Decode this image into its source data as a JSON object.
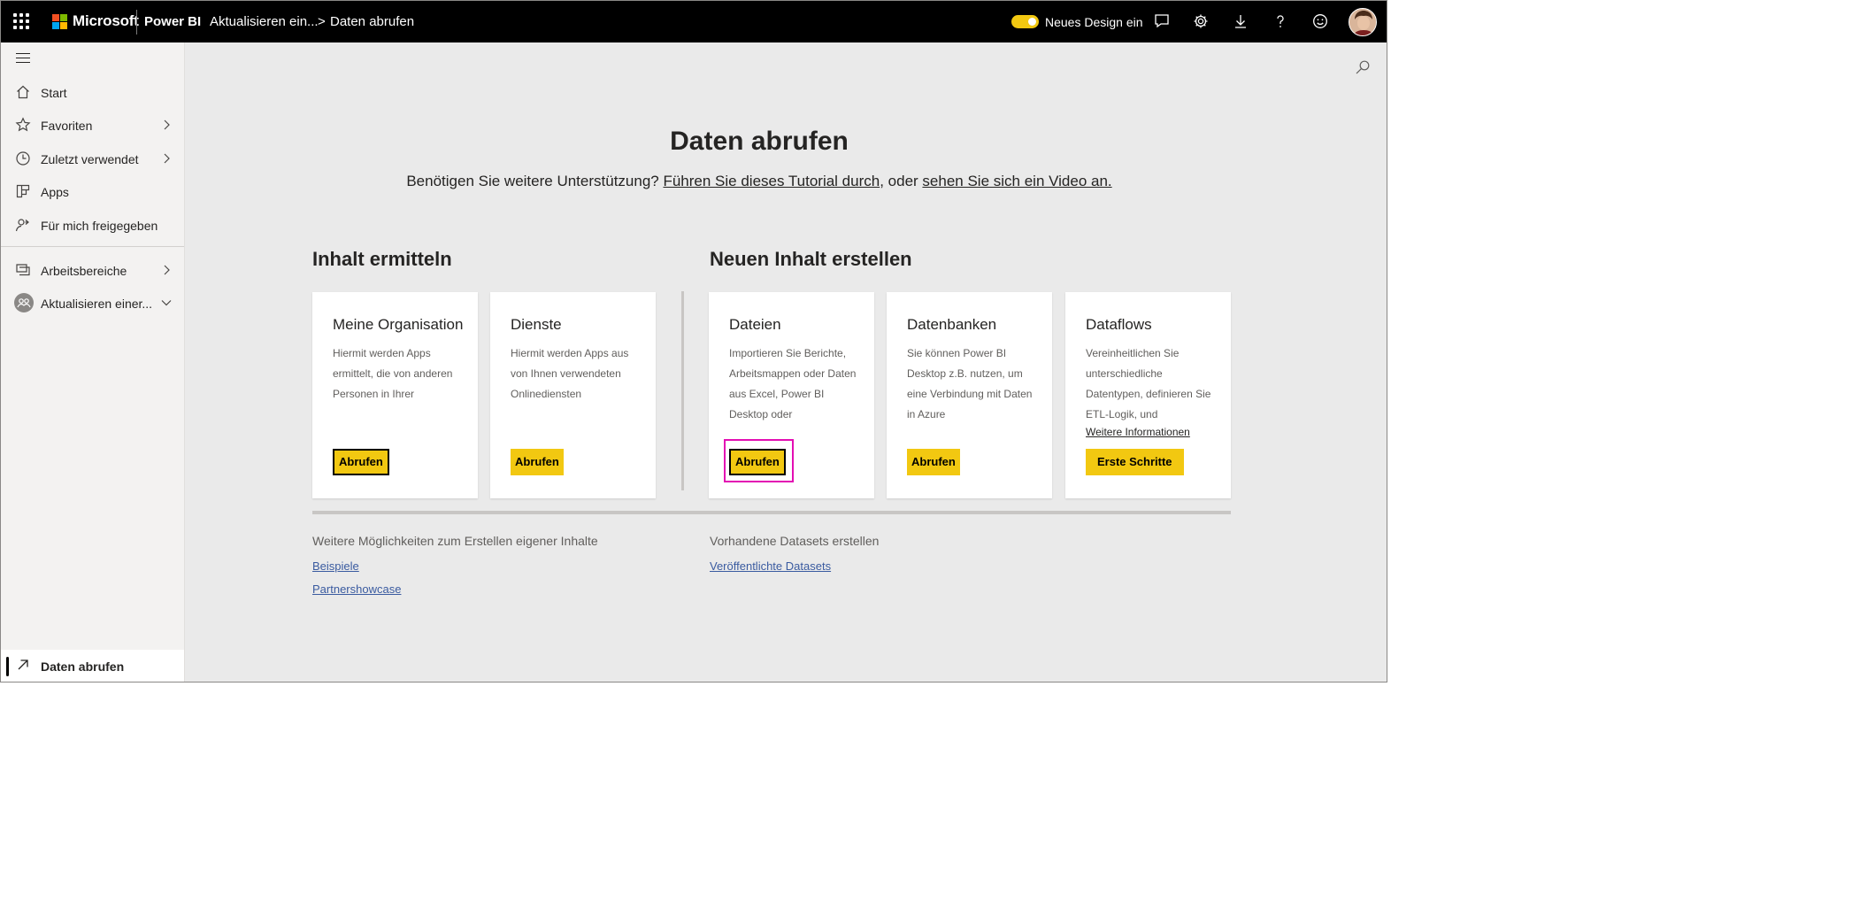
{
  "topbar": {
    "brand": "Microsoft",
    "product": "Power BI",
    "breadcrumb_workspace": "Aktualisieren ein...",
    "breadcrumb_chevron": ">",
    "breadcrumb_page": "Daten abrufen",
    "toggle_label": "Neues Design ein",
    "toggle_on": true,
    "icons": [
      "waffle-icon",
      "feedback-icon",
      "settings-icon",
      "download-icon",
      "help-icon",
      "smiley-icon"
    ],
    "logo_colors": [
      "#f25022",
      "#7fba00",
      "#00a4ef",
      "#ffb900"
    ]
  },
  "sidebar": {
    "items": [
      {
        "label": "Start",
        "icon": "home-icon",
        "has_chevron": false
      },
      {
        "label": "Favoriten",
        "icon": "star-icon",
        "has_chevron": true
      },
      {
        "label": "Zuletzt verwendet",
        "icon": "clock-icon",
        "has_chevron": true
      },
      {
        "label": "Apps",
        "icon": "apps-icon",
        "has_chevron": false
      },
      {
        "label": "Für mich freigegeben",
        "icon": "shared-icon",
        "has_chevron": false
      },
      {
        "label": "Arbeitsbereiche",
        "icon": "workspaces-icon",
        "has_chevron": true
      },
      {
        "label": "Aktualisieren einer...",
        "icon": "workspace-avatar-icon",
        "has_chevron": true
      }
    ],
    "bottom_item": {
      "label": "Daten abrufen",
      "icon": "arrow-up-right-icon"
    }
  },
  "main": {
    "title": "Daten abrufen",
    "help_prefix": "Benötigen Sie weitere Unterstützung? ",
    "help_link1": "Führen Sie dieses Tutorial durch",
    "help_middle": ", oder ",
    "help_link2": "sehen Sie sich ein Video an.",
    "section_discover": "Inhalt ermitteln",
    "section_create": "Neuen Inhalt erstellen",
    "cards": [
      {
        "title": "Meine Organisation",
        "description": "Hiermit werden Apps ermittelt, die von anderen Personen in Ihrer",
        "button": "Abrufen"
      },
      {
        "title": "Dienste",
        "description": "Hiermit werden Apps aus von Ihnen verwendeten Onlinediensten",
        "button": "Abrufen"
      },
      {
        "title": "Dateien",
        "description": "Importieren Sie Berichte, Arbeitsmappen oder Daten aus Excel, Power BI Desktop oder",
        "button": "Abrufen"
      },
      {
        "title": "Datenbanken",
        "description": "Sie können Power BI Desktop z.B. nutzen, um eine Verbindung mit Daten in Azure",
        "button": "Abrufen"
      },
      {
        "title": "Dataflows",
        "description": "Vereinheitlichen Sie unterschiedliche Datentypen, definieren Sie ETL-Logik, und",
        "link": "Weitere Informationen",
        "button": "Erste Schritte"
      }
    ],
    "more_title": "Weitere Möglichkeiten zum Erstellen eigener Inhalte",
    "more_links": [
      "Beispiele",
      "Partnershowcase"
    ],
    "datasets_title": "Vorhandene Datasets erstellen",
    "datasets_link": "Veröffentlichte Datasets"
  },
  "colors": {
    "accent_yellow": "#f2c811",
    "highlight_magenta": "#e30eb3",
    "link_blue": "#3a5ba0"
  }
}
